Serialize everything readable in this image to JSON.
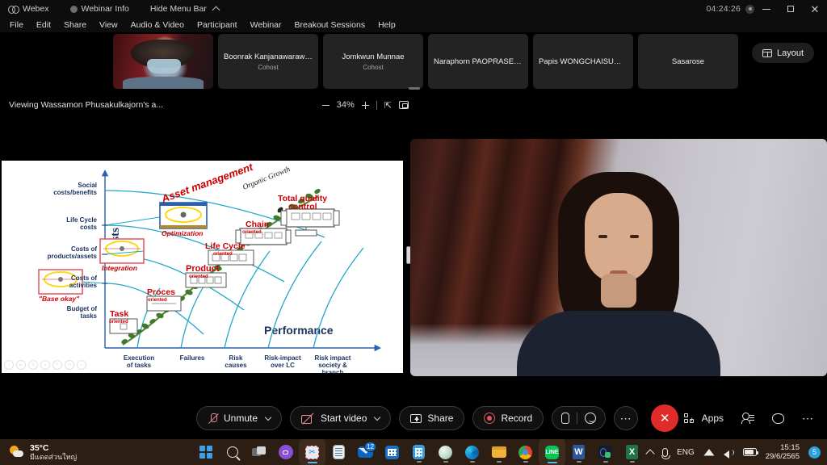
{
  "titlebar": {
    "app_name": "Webex",
    "webinar_info": "Webinar Info",
    "hide_menu_bar": "Hide Menu Bar",
    "timer": "04:24:26",
    "icons": {
      "webex_logo": "webex-logo-icon",
      "info": "info-icon",
      "collapse": "chevron-up-icon",
      "record_state": "record-status-icon",
      "minimize": "minimize-icon",
      "maximize": "maximize-icon",
      "close": "close-icon"
    }
  },
  "menubar": {
    "items": [
      {
        "label": "File"
      },
      {
        "label": "Edit"
      },
      {
        "label": "Share"
      },
      {
        "label": "View"
      },
      {
        "label": "Audio & Video"
      },
      {
        "label": "Participant"
      },
      {
        "label": "Webinar"
      },
      {
        "label": "Breakout Sessions"
      },
      {
        "label": "Help"
      }
    ]
  },
  "filmstrip": {
    "tiles": [
      {
        "name": "",
        "role": "",
        "has_video": true
      },
      {
        "name": "Boonrak Kanjanawarawa...",
        "role": "Cohost",
        "has_video": false
      },
      {
        "name": "Jomkwun Munnae",
        "role": "Cohost",
        "has_video": false
      },
      {
        "name": "Naraphorn PAOPRASERT",
        "role": "",
        "has_video": false
      },
      {
        "name": "Papis WONGCHAISUWAT",
        "role": "",
        "has_video": false
      },
      {
        "name": "Sasarose",
        "role": "",
        "has_video": false
      }
    ]
  },
  "layout_button": {
    "label": "Layout",
    "icon": "layout-grid-icon"
  },
  "sharebar": {
    "title": "Viewing Wassamon Phusakulkajorn's a...",
    "zoom_level": "34%",
    "zoom_out_icon": "minus-icon",
    "zoom_in_icon": "plus-icon",
    "fit_icon": "fit-to-width-icon",
    "fullscreen_icon": "screen-icon"
  },
  "slide": {
    "annotation_tools": [
      "back-icon",
      "play-icon",
      "pen-icon",
      "stop-icon",
      "zoom-icon",
      "list-icon",
      "minus-icon"
    ]
  },
  "chart_data": {
    "type": "scatter",
    "title": "",
    "xlabel": "Performance",
    "ylabel": "Costs",
    "axis_color": "#1f3f8f",
    "curve_color": "#1fa8c9",
    "label_color": "#cc0000",
    "y_tick_labels": [
      "Social\ncosts/benefits",
      "Life Cycle\ncosts",
      "Costs of\nproducts/assets",
      "Costs of\nactivities",
      "Budget of\ntasks"
    ],
    "y_ticks": [
      {
        "line1": "Social",
        "line2": "costs/benefits"
      },
      {
        "line1": "Life Cycle",
        "line2": "costs"
      },
      {
        "line1": "Costs of",
        "line2": "products/assets"
      },
      {
        "line1": "Costs of",
        "line2": "activities"
      },
      {
        "line1": "Budget of",
        "line2": "tasks"
      }
    ],
    "x_ticks": [
      {
        "line1": "Execution",
        "line2": "of tasks",
        "line3": ""
      },
      {
        "line1": "Failures",
        "line2": "",
        "line3": ""
      },
      {
        "line1": "Risk",
        "line2": "causes",
        "line3": ""
      },
      {
        "line1": "Risk-impact",
        "line2": "over LC",
        "line3": ""
      },
      {
        "line1": "Risk impact",
        "line2": "society &",
        "line3": "branch"
      }
    ],
    "maturity_stages": [
      {
        "line1": "Task",
        "line2": "oriented",
        "x": 38,
        "y": 195
      },
      {
        "line1": "Proces",
        "line2": "oriented",
        "x": 89,
        "y": 167
      },
      {
        "line1": "Product",
        "line2": "oriented",
        "x": 143,
        "y": 140
      },
      {
        "line1": "Life Cycle",
        "line2": "oriented",
        "x": 196,
        "y": 112
      },
      {
        "line1": "Chain",
        "line2": "oriented",
        "x": 249,
        "y": 86
      },
      {
        "line1": "Total quality",
        "line2": "control",
        "x": 310,
        "y": 63
      }
    ],
    "annotations": [
      {
        "text": "Asset management",
        "rotation": -22,
        "x": 150,
        "y": 38,
        "color": "#cc0000"
      },
      {
        "text": "Organic Growth",
        "rotation": -22,
        "x": 272,
        "y": 25,
        "color": "#222222"
      },
      {
        "text": "Integration",
        "x": 120,
        "y": 138,
        "color": "#cc0000"
      },
      {
        "text": "Optimization",
        "x": 196,
        "y": 93,
        "color": "#cc0000"
      },
      {
        "text": "\"Base okay\"",
        "x": 58,
        "y": 170,
        "color": "#cc0000"
      }
    ],
    "grid": false,
    "legend": "none"
  },
  "controlbar": {
    "buttons": [
      {
        "label": "Unmute",
        "icon": "mic-muted-icon",
        "has_caret": true
      },
      {
        "label": "Start video",
        "icon": "camera-off-icon",
        "has_caret": true
      },
      {
        "label": "Share",
        "icon": "share-screen-icon",
        "has_caret": false
      },
      {
        "label": "Record",
        "icon": "record-icon",
        "has_caret": false
      }
    ],
    "reactions": {
      "hand_icon": "raise-hand-icon",
      "emoji_icon": "reactions-smiley-icon"
    },
    "more_icon": "more-options-icon",
    "end_call_icon": "end-meeting-icon",
    "right_items": [
      {
        "label": "Apps",
        "icon": "apps-grid-icon"
      },
      {
        "label": "",
        "icon": "participants-icon"
      },
      {
        "label": "",
        "icon": "chat-bubble-icon"
      },
      {
        "label": "",
        "icon": "more-horizontal-icon"
      }
    ]
  },
  "taskbar": {
    "weather": {
      "temp": "35°C",
      "desc": "มีแดดส่วนใหญ่",
      "icon": "sun-cloud-icon"
    },
    "icons": [
      {
        "name": "start-icon",
        "state": ""
      },
      {
        "name": "search-icon",
        "state": ""
      },
      {
        "name": "task-view-icon",
        "state": ""
      },
      {
        "name": "webex-app-icon",
        "state": ""
      },
      {
        "name": "snipping-tool-icon",
        "state": "active"
      },
      {
        "name": "notepad-icon",
        "state": ""
      },
      {
        "name": "mail-icon",
        "state": "",
        "badge": "12"
      },
      {
        "name": "calendar-icon",
        "state": ""
      },
      {
        "name": "calculator-icon",
        "state": "open"
      },
      {
        "name": "browser-icon",
        "state": "open"
      },
      {
        "name": "edge-icon",
        "state": "open"
      },
      {
        "name": "file-explorer-icon",
        "state": "open"
      },
      {
        "name": "chrome-icon",
        "state": "open"
      },
      {
        "name": "line-icon",
        "state": "active"
      },
      {
        "name": "word-icon",
        "state": "open"
      },
      {
        "name": "office-icon",
        "state": "open"
      },
      {
        "name": "excel-icon",
        "state": "open"
      }
    ],
    "tray": {
      "language": "ENG",
      "time": "15:15",
      "date": "29/6/2565",
      "notification_count": "5",
      "icons": [
        "tray-chevron-icon",
        "microphone-icon",
        "wifi-icon",
        "volume-icon",
        "battery-icon"
      ]
    }
  }
}
